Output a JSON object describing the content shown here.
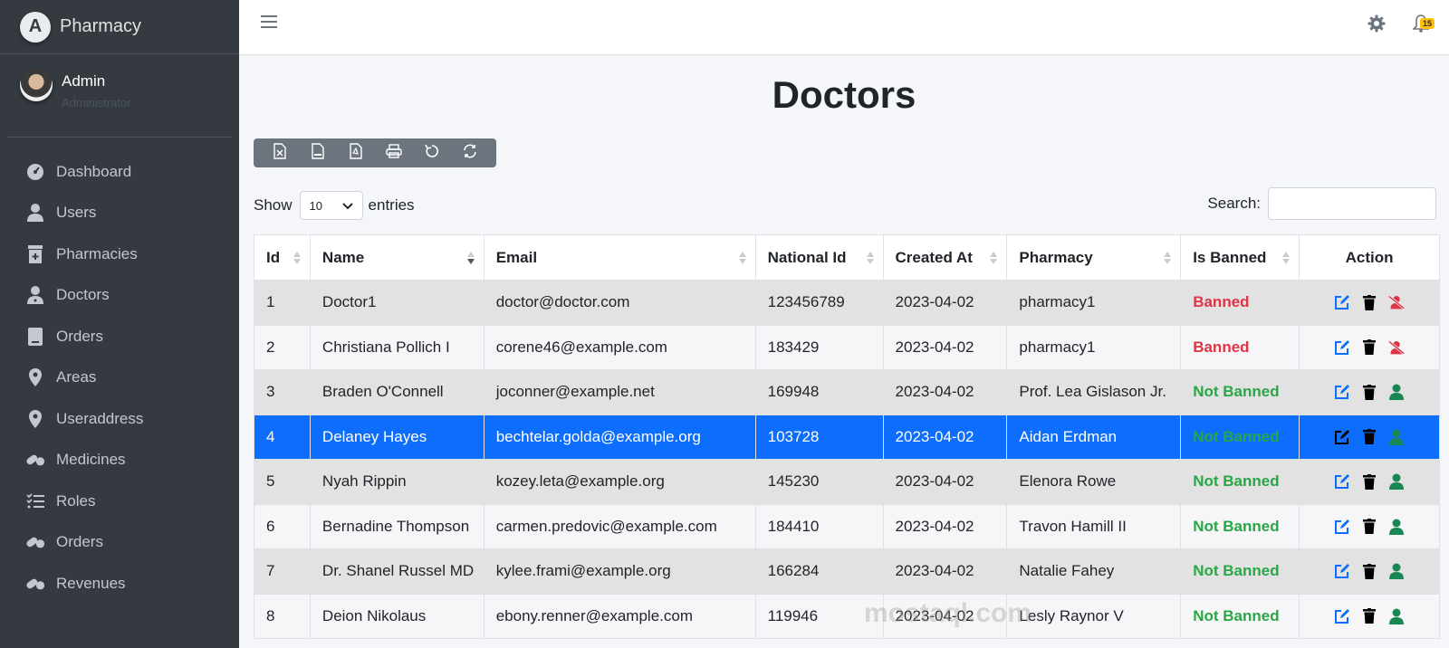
{
  "brand": {
    "name": "Pharmacy",
    "logo_letter": "A"
  },
  "user": {
    "name": "Admin",
    "role": "Administrator"
  },
  "nav": [
    {
      "label": "Dashboard",
      "icon": "tachometer-icon"
    },
    {
      "label": "Users",
      "icon": "user-icon"
    },
    {
      "label": "Pharmacies",
      "icon": "clinic-icon"
    },
    {
      "label": "Doctors",
      "icon": "doctor-icon"
    },
    {
      "label": "Orders",
      "icon": "receipt-icon"
    },
    {
      "label": "Areas",
      "icon": "map-marker-icon"
    },
    {
      "label": "Useraddress",
      "icon": "map-marker-icon"
    },
    {
      "label": "Medicines",
      "icon": "pills-icon"
    },
    {
      "label": "Roles",
      "icon": "tasks-icon"
    },
    {
      "label": "Orders",
      "icon": "pills-icon"
    },
    {
      "label": "Revenues",
      "icon": "pills-icon"
    }
  ],
  "topbar": {
    "notification_count": "15"
  },
  "page": {
    "title": "Doctors"
  },
  "table_controls": {
    "show_label": "Show",
    "entries_value": "10",
    "entries_label": "entries",
    "search_label": "Search:"
  },
  "columns": [
    "Id",
    "Name",
    "Email",
    "National Id",
    "Created At",
    "Pharmacy",
    "Is Banned",
    "Action"
  ],
  "rows": [
    {
      "id": "1",
      "name": "Doctor1",
      "email": "doctor@doctor.com",
      "national_id": "123456789",
      "created_at": "2023-04-02",
      "pharmacy": "pharmacy1",
      "status": "Banned"
    },
    {
      "id": "2",
      "name": "Christiana Pollich I",
      "email": "corene46@example.com",
      "national_id": "183429",
      "created_at": "2023-04-02",
      "pharmacy": "pharmacy1",
      "status": "Banned"
    },
    {
      "id": "3",
      "name": "Braden O'Connell",
      "email": "joconner@example.net",
      "national_id": "169948",
      "created_at": "2023-04-02",
      "pharmacy": "Prof. Lea Gislason Jr.",
      "status": "Not Banned"
    },
    {
      "id": "4",
      "name": "Delaney Hayes",
      "email": "bechtelar.golda@example.org",
      "national_id": "103728",
      "created_at": "2023-04-02",
      "pharmacy": "Aidan Erdman",
      "status": "Not Banned"
    },
    {
      "id": "5",
      "name": "Nyah Rippin",
      "email": "kozey.leta@example.org",
      "national_id": "145230",
      "created_at": "2023-04-02",
      "pharmacy": "Elenora Rowe",
      "status": "Not Banned"
    },
    {
      "id": "6",
      "name": "Bernadine Thompson",
      "email": "carmen.predovic@example.com",
      "national_id": "184410",
      "created_at": "2023-04-02",
      "pharmacy": "Travon Hamill II",
      "status": "Not Banned"
    },
    {
      "id": "7",
      "name": "Dr. Shanel Russel MD",
      "email": "kylee.frami@example.org",
      "national_id": "166284",
      "created_at": "2023-04-02",
      "pharmacy": "Natalie Fahey",
      "status": "Not Banned"
    },
    {
      "id": "8",
      "name": "Deion Nikolaus",
      "email": "ebony.renner@example.com",
      "national_id": "119946",
      "created_at": "2023-04-02",
      "pharmacy": "Lesly Raynor V",
      "status": "Not Banned"
    }
  ],
  "watermark": "mostaql.com",
  "colors": {
    "sidebar": "#343a40",
    "selected_row": "#0d6efd",
    "banned": "#dc3545",
    "not_banned": "#28a745",
    "edit": "#0d6efd"
  }
}
